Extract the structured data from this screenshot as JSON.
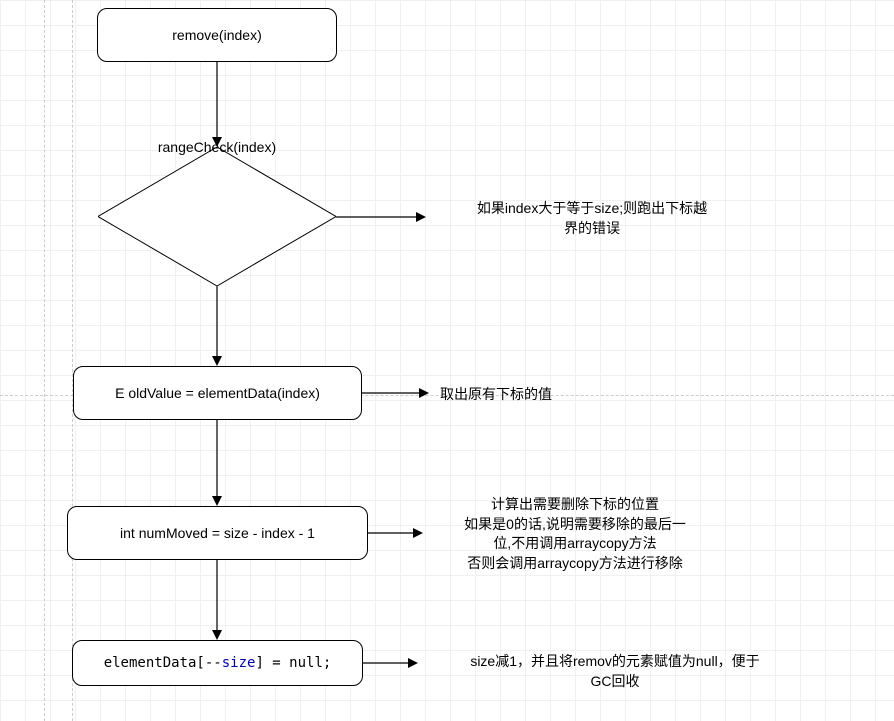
{
  "nodes": {
    "n1": "remove(index)",
    "n2": "rangeCheck(index)",
    "n3": "E oldValue = elementData(index)",
    "n4": "int numMoved = size - index - 1",
    "n5_pre": "elementData[--",
    "n5_kw": "size",
    "n5_post": "] = null;"
  },
  "annotations": {
    "a2a": "如果index大于等于size;则跑出下标越",
    "a2b": "界的错误",
    "a3": "取出原有下标的值",
    "a4a": "计算出需要删除下标的位置",
    "a4b": "如果是0的话,说明需要移除的最后一",
    "a4c": "位,不用调用arraycopy方法",
    "a4d": "否则会调用arraycopy方法进行移除",
    "a5a": "size减1，并且将remov的元素赋值为null，便于",
    "a5b": "GC回收"
  }
}
